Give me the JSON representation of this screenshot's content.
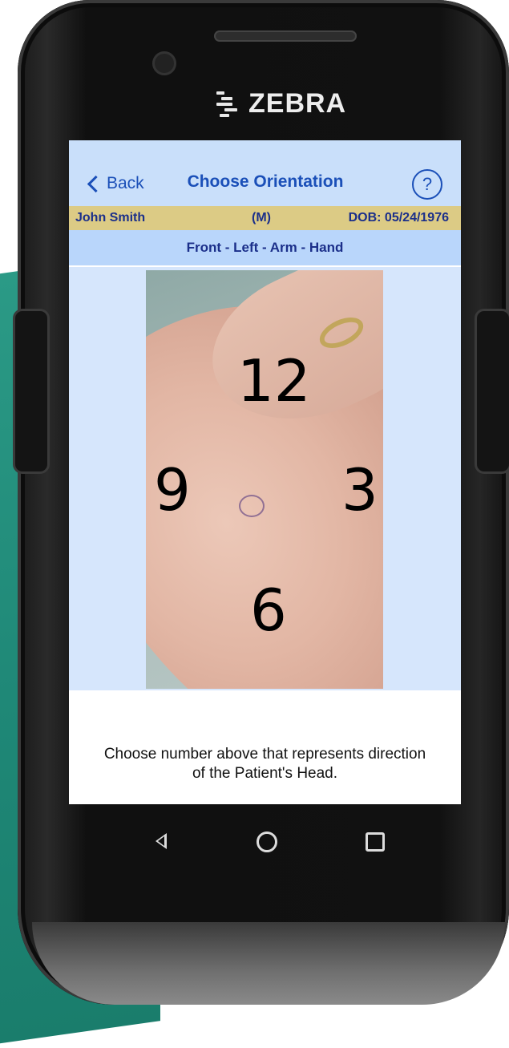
{
  "device": {
    "brand": "ZEBRA"
  },
  "nav": {
    "back_label": "Back",
    "title": "Choose Orientation",
    "help_label": "?"
  },
  "patient": {
    "name": "John Smith",
    "sex": "(M)",
    "dob": "DOB: 05/24/1976"
  },
  "location": {
    "label": "Front  - Left - Arm - Hand"
  },
  "orientation": {
    "top": "12",
    "left": "9",
    "right": "3",
    "bottom": "6"
  },
  "instruction": {
    "line1": "Choose number above that represents direction",
    "line2": "of the Patient's Head."
  },
  "colors": {
    "nav_bg": "#c9dffa",
    "accent": "#1a4fb8",
    "patient_bar": "#dccb85",
    "location_bar": "#b9d6fb",
    "image_area": "#d6e6fc",
    "background_teal": "#1f8877"
  },
  "icons": {
    "back": "chevron-left-icon",
    "help": "question-circle-icon",
    "android_back": "triangle-back-icon",
    "android_home": "circle-home-icon",
    "android_recent": "square-recent-icon"
  }
}
